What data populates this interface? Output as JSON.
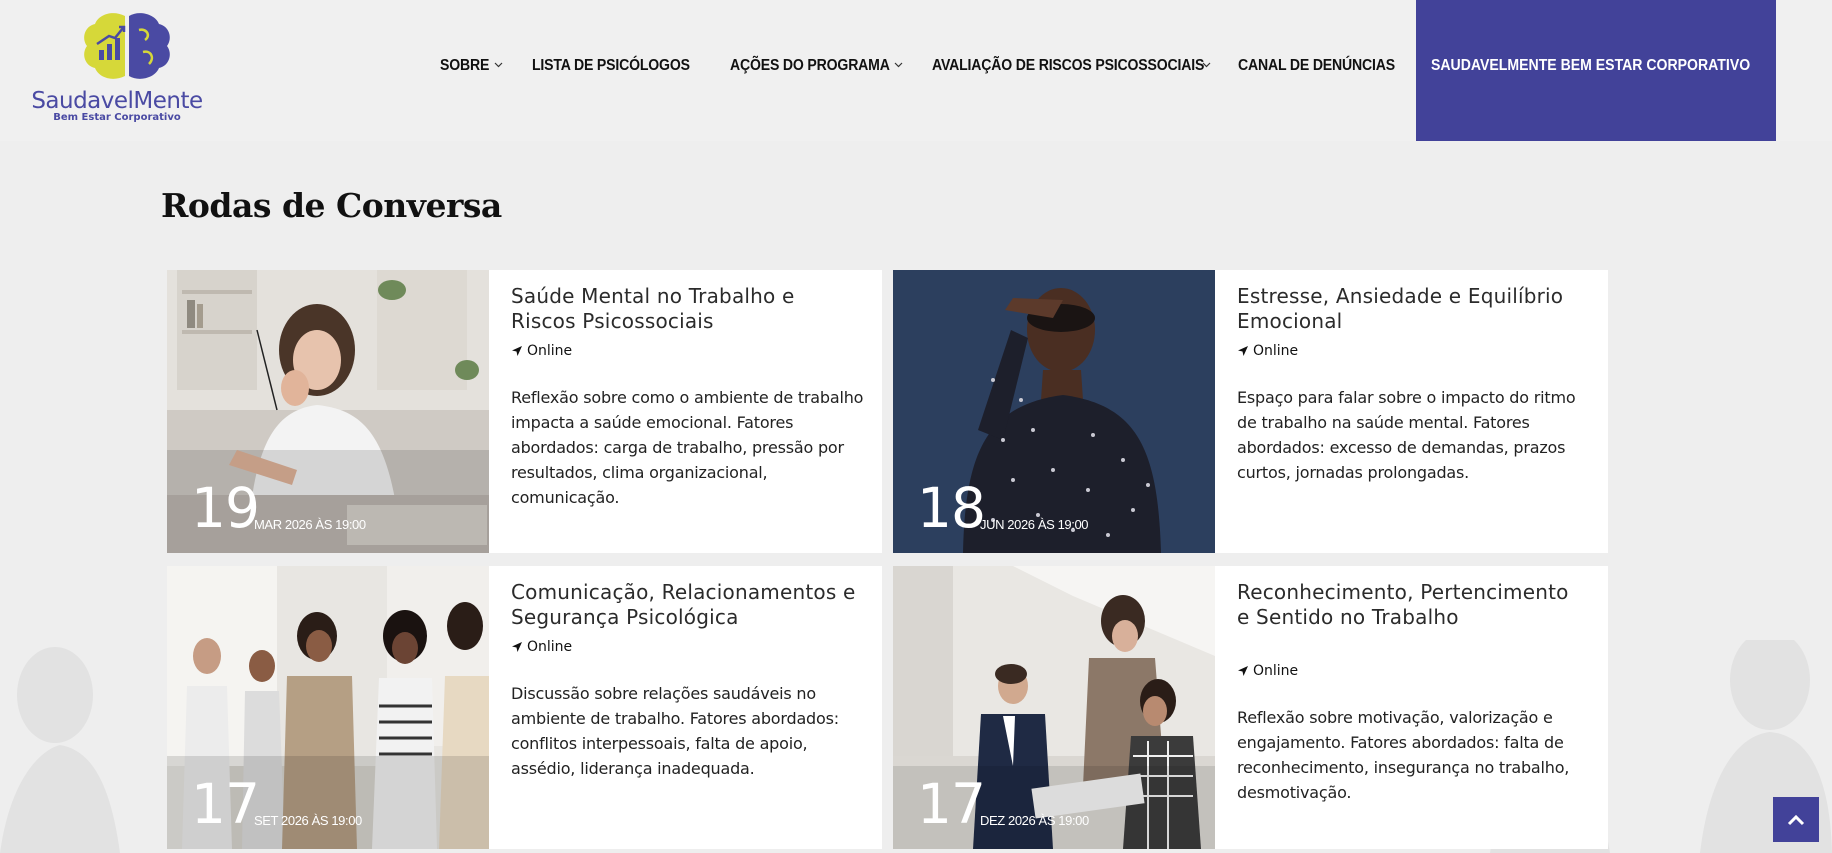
{
  "brand": {
    "name": "SaudavelMente",
    "tagline": "Bem Estar Corporativo",
    "icon": "brain-chart-logo"
  },
  "nav": {
    "items": [
      {
        "label": "SOBRE",
        "has_dropdown": true
      },
      {
        "label": "LISTA DE PSICÓLOGOS",
        "has_dropdown": false
      },
      {
        "label": "AÇÕES DO PROGRAMA",
        "has_dropdown": true
      },
      {
        "label": "AVALIAÇÃO DE RISCOS PSICOSSOCIAIS",
        "has_dropdown": true
      },
      {
        "label": "CANAL DE DENÚNCIAS",
        "has_dropdown": false
      }
    ],
    "cta_label": "SAUDAVELMENTE BEM ESTAR CORPORATIVO",
    "cta_color": "#424299"
  },
  "section": {
    "title": "Rodas de Conversa"
  },
  "events": [
    {
      "title": "Saúde Mental no Trabalho e Riscos Psicossociais",
      "location": "Online",
      "description": "Reflexão sobre como o ambiente de trabalho impacta a saúde emocional. Fatores abordados: carga de trabalho, pressão por resultados, clima organizacional, comunicação.",
      "day": "19",
      "date_rest": "MAR 2026 ÀS 19:00"
    },
    {
      "title": "Estresse, Ansiedade e Equilíbrio Emocional",
      "location": "Online",
      "description": "Espaço para falar sobre o impacto do ritmo de trabalho na saúde mental. Fatores abordados: excesso de demandas, prazos curtos, jornadas prolongadas.",
      "day": "18",
      "date_rest": "JUN 2026 ÀS 19:00"
    },
    {
      "title": "Comunicação, Relacionamentos e Segurança Psicológica",
      "location": "Online",
      "description": "Discussão sobre relações saudáveis no ambiente de trabalho. Fatores abordados: conflitos interpessoais, falta de apoio, assédio, liderança inadequada.",
      "day": "17",
      "date_rest": "SET 2026 ÀS 19:00"
    },
    {
      "title": "Reconhecimento, Pertencimento e Sentido no Trabalho",
      "location": "Online",
      "description": "Reflexão sobre motivação, valorização e engajamento. Fatores abordados: falta de reconhecimento, insegurança no trabalho, desmotivação.",
      "day": "17",
      "date_rest": "DEZ 2026 ÀS 19:00"
    }
  ],
  "icons": {
    "location": "location-arrow-icon",
    "dropdown": "chevron-down-icon",
    "back_to_top": "chevron-up-icon"
  }
}
